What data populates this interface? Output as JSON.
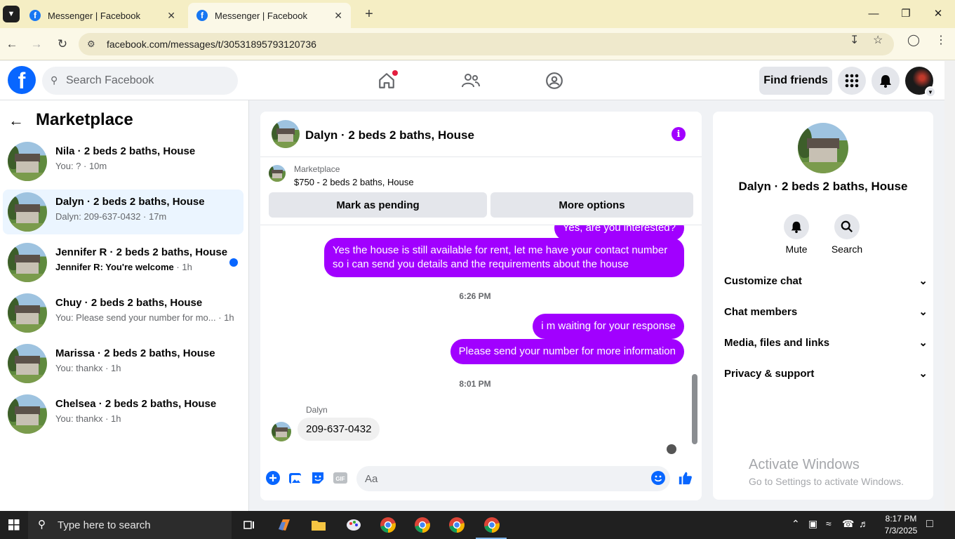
{
  "browser": {
    "tabs": [
      {
        "title": "Messenger | Facebook",
        "favicon": "facebook-icon"
      },
      {
        "title": "Messenger | Facebook",
        "favicon": "facebook-icon"
      }
    ],
    "url": "facebook.com/messages/t/30531895793120736"
  },
  "fb": {
    "logo": "f",
    "search_placeholder": "Search Facebook",
    "find_friends": "Find friends"
  },
  "sidebar": {
    "title": "Marketplace",
    "conversations": [
      {
        "name": "Nila · 2 beds 2 baths, House",
        "preview": "You: ? · 10m",
        "selected": false,
        "unread": false
      },
      {
        "name": "Dalyn · 2 beds 2 baths, House",
        "preview": "Dalyn: 209-637-0432 · 17m",
        "selected": true,
        "unread": false
      },
      {
        "name": "Jennifer R · 2 beds 2 baths, House",
        "preview": "Jennifer R: You're welcome",
        "preview_time": " · 1h",
        "selected": false,
        "unread": true
      },
      {
        "name": "Chuy · 2 beds 2 baths, House",
        "preview": "You: Please send your number for mo... · 1h",
        "selected": false,
        "unread": false
      },
      {
        "name": "Marissa · 2 beds 2 baths, House",
        "preview": "You: thankx · 1h",
        "selected": false,
        "unread": false
      },
      {
        "name": "Chelsea · 2 beds 2 baths, House",
        "preview": "You: thankx · 1h",
        "selected": false,
        "unread": false
      }
    ]
  },
  "chat": {
    "title": "Dalyn · 2 beds 2 baths, House",
    "marketplace_label": "Marketplace",
    "listing": "$750 - 2 beds 2 baths, House",
    "mark_pending": "Mark as pending",
    "more_options": "More options",
    "messages": {
      "partial": "Yes, are you interested?",
      "m1": "Yes the house is still available for rent, let me have your contact number so i can send you details and the requirements about the house",
      "time1": "6:26 PM",
      "m2": "i m waiting for your response",
      "m3": "Please send your number for more information",
      "time2": "8:01 PM",
      "sender": "Dalyn",
      "m4": "209-637-0432"
    },
    "input_placeholder": "Aa"
  },
  "details": {
    "name": "Dalyn · 2 beds 2 baths, House",
    "mute": "Mute",
    "search": "Search",
    "sections": [
      "Customize chat",
      "Chat members",
      "Media, files and links",
      "Privacy & support"
    ]
  },
  "watermark": {
    "line1": "Activate Windows",
    "line2": "Go to Settings to activate Windows."
  },
  "taskbar": {
    "search_placeholder": "Type here to search",
    "time": "8:17 PM",
    "date": "7/3/2025"
  },
  "colors": {
    "messenger_purple": "#a100ff",
    "fb_blue": "#0866ff",
    "selected_row": "#ebf5ff"
  }
}
